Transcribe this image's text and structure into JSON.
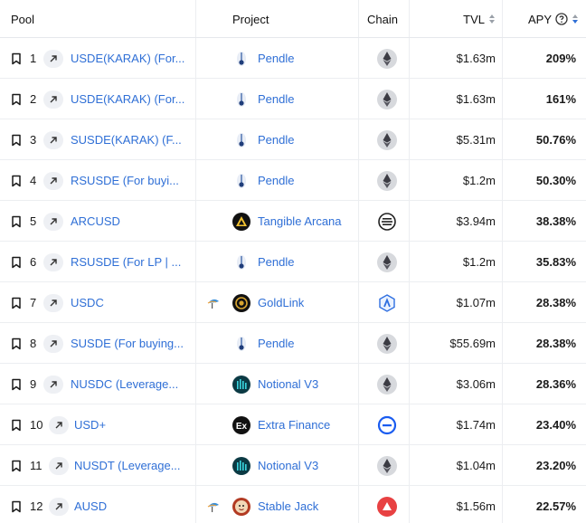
{
  "header": {
    "pool": "Pool",
    "project": "Project",
    "chain": "Chain",
    "tvl": "TVL",
    "apy": "APY"
  },
  "rows": [
    {
      "rank": "1",
      "pool": "USDE(KARAK) (For...",
      "project": "Pendle",
      "project_logo": "pendle",
      "chain": "ethereum",
      "tvl": "$1.63m",
      "apy": "209%",
      "partner": false
    },
    {
      "rank": "2",
      "pool": "USDE(KARAK) (For...",
      "project": "Pendle",
      "project_logo": "pendle",
      "chain": "ethereum",
      "tvl": "$1.63m",
      "apy": "161%",
      "partner": false
    },
    {
      "rank": "3",
      "pool": "SUSDE(KARAK) (F...",
      "project": "Pendle",
      "project_logo": "pendle",
      "chain": "ethereum",
      "tvl": "$5.31m",
      "apy": "50.76%",
      "partner": false
    },
    {
      "rank": "4",
      "pool": "RSUSDE (For buyi...",
      "project": "Pendle",
      "project_logo": "pendle",
      "chain": "ethereum",
      "tvl": "$1.2m",
      "apy": "50.30%",
      "partner": false
    },
    {
      "rank": "5",
      "pool": "ARCUSD",
      "project": "Tangible Arcana",
      "project_logo": "tangible",
      "chain": "real",
      "tvl": "$3.94m",
      "apy": "38.38%",
      "partner": false
    },
    {
      "rank": "6",
      "pool": "RSUSDE (For LP | ...",
      "project": "Pendle",
      "project_logo": "pendle",
      "chain": "ethereum",
      "tvl": "$1.2m",
      "apy": "35.83%",
      "partner": false
    },
    {
      "rank": "7",
      "pool": "USDC",
      "project": "GoldLink",
      "project_logo": "goldlink",
      "chain": "arbitrum",
      "tvl": "$1.07m",
      "apy": "28.38%",
      "partner": true
    },
    {
      "rank": "8",
      "pool": "SUSDE (For buying...",
      "project": "Pendle",
      "project_logo": "pendle",
      "chain": "ethereum",
      "tvl": "$55.69m",
      "apy": "28.38%",
      "partner": false
    },
    {
      "rank": "9",
      "pool": "NUSDC (Leverage...",
      "project": "Notional V3",
      "project_logo": "notional",
      "chain": "ethereum",
      "tvl": "$3.06m",
      "apy": "28.36%",
      "partner": false
    },
    {
      "rank": "10",
      "pool": "USD+",
      "project": "Extra Finance",
      "project_logo": "extra",
      "chain": "base",
      "tvl": "$1.74m",
      "apy": "23.40%",
      "partner": false
    },
    {
      "rank": "11",
      "pool": "NUSDT (Leverage...",
      "project": "Notional V3",
      "project_logo": "notional",
      "chain": "ethereum",
      "tvl": "$1.04m",
      "apy": "23.20%",
      "partner": false
    },
    {
      "rank": "12",
      "pool": "AUSD",
      "project": "Stable Jack",
      "project_logo": "stablejack",
      "chain": "avalanche",
      "tvl": "$1.56m",
      "apy": "22.57%",
      "partner": true
    }
  ]
}
